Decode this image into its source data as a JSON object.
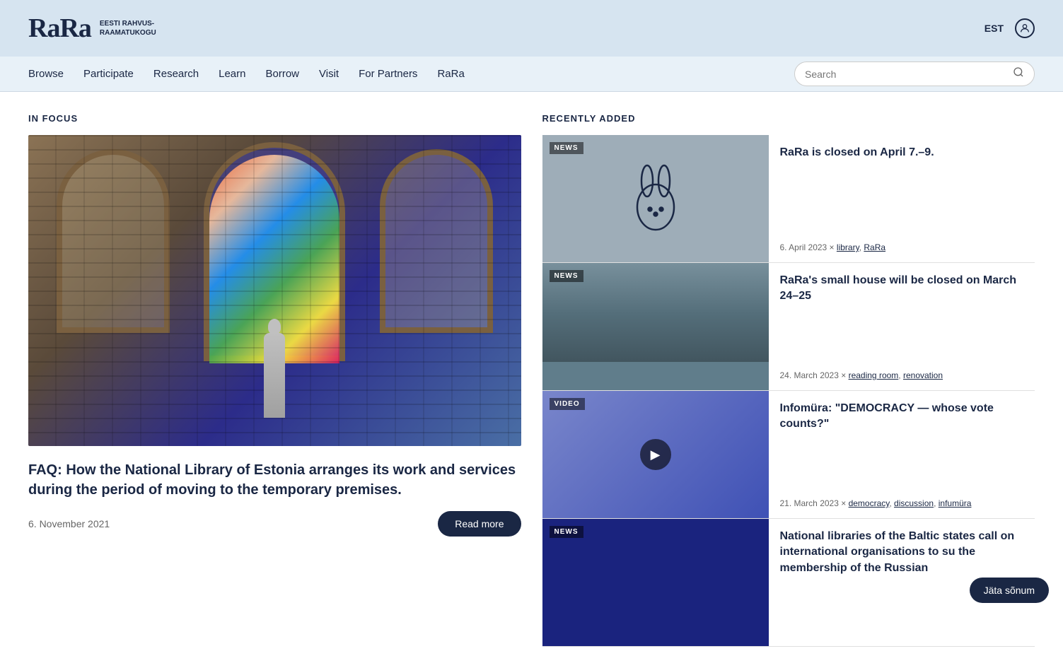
{
  "header": {
    "logo_main": "RaRa",
    "logo_sub_line1": "EESTI RAHVUS-",
    "logo_sub_line2": "RAAMATUKOGU",
    "lang": "EST"
  },
  "nav": {
    "links": [
      "Browse",
      "Participate",
      "Research",
      "Learn",
      "Borrow",
      "Visit",
      "For Partners",
      "RaRa"
    ],
    "search_placeholder": "Search"
  },
  "in_focus": {
    "section_title": "IN FOCUS",
    "article_title": "FAQ: How the National Library of Estonia arranges its work and services during the period of moving to the temporary premises.",
    "article_date": "6. November 2021",
    "read_more_label": "Read more"
  },
  "recently_added": {
    "section_title": "RECENTLY ADDED",
    "items": [
      {
        "badge": "NEWS",
        "title": "RaRa is closed on April 7.–9.",
        "date": "6. April 2023",
        "tags": [
          "library",
          "RaRa"
        ],
        "type": "bunny"
      },
      {
        "badge": "NEWS",
        "title": "RaRa's small house will be closed on March 24–25",
        "date": "24. March 2023",
        "tags": [
          "reading room",
          "renovation"
        ],
        "type": "street"
      },
      {
        "badge": "VIDEO",
        "title": "Infomüra: \"DEMOCRACY — whose vote counts?\"",
        "date": "21. March 2023",
        "tags": [
          "democracy",
          "discussion",
          "infumüra"
        ],
        "type": "video"
      },
      {
        "badge": "NEWS",
        "title": "National libraries of the Baltic states call on international organisations to su the membership of the Russian",
        "date": "",
        "tags": [],
        "type": "dark"
      }
    ]
  },
  "footer": {
    "jata_sonum": "Jäta sõnum"
  }
}
